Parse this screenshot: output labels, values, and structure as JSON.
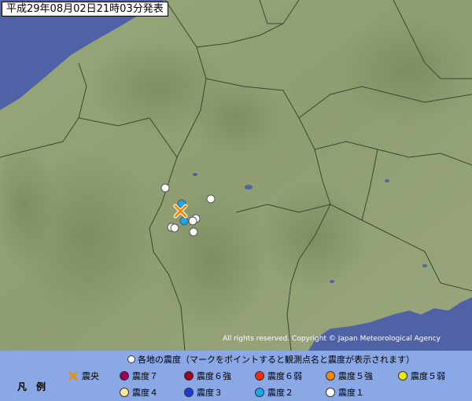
{
  "header": {
    "title": "平成29年08月02日21時03分発表"
  },
  "copyright": "All rights reserved. Copyright © Japan Meteorological Agency",
  "legend": {
    "heading": "各地の震度（マークをポイントすると観測点名と震度が表示されます）",
    "title": "凡　例",
    "epicenter_label": "震央",
    "items": [
      {
        "label": "震度７",
        "color": "#a0005a"
      },
      {
        "label": "震度６強",
        "color": "#a00018"
      },
      {
        "label": "震度６弱",
        "color": "#f02c00"
      },
      {
        "label": "震度５強",
        "color": "#f08c00"
      },
      {
        "label": "震度５弱",
        "color": "#f0e800"
      },
      {
        "label": "震度４",
        "color": "#ffe69a"
      },
      {
        "label": "震度３",
        "color": "#1c3cd8"
      },
      {
        "label": "震度２",
        "color": "#18a8f0"
      },
      {
        "label": "震度１",
        "color": "#ffffff"
      }
    ]
  },
  "epicenter": {
    "color": "#f08c00"
  },
  "stations": [
    {
      "intensity": "1"
    },
    {
      "intensity": "2"
    },
    {
      "intensity": "1"
    },
    {
      "intensity": "1"
    },
    {
      "intensity": "1"
    },
    {
      "intensity": "2"
    },
    {
      "intensity": "1"
    },
    {
      "intensity": "1"
    },
    {
      "intensity": "1"
    }
  ]
}
